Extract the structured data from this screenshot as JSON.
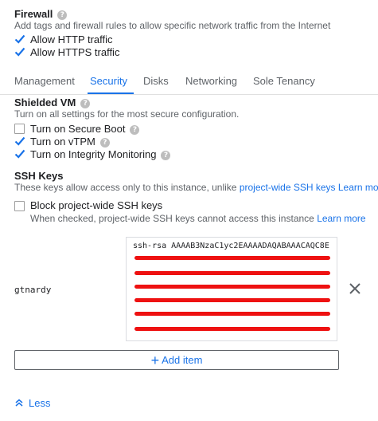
{
  "firewall": {
    "title": "Firewall",
    "description": "Add tags and firewall rules to allow specific network traffic from the Internet",
    "http_label": "Allow HTTP traffic",
    "http_checked": true,
    "https_label": "Allow HTTPS traffic",
    "https_checked": true
  },
  "tabs": [
    {
      "label": "Management",
      "active": false
    },
    {
      "label": "Security",
      "active": true
    },
    {
      "label": "Disks",
      "active": false
    },
    {
      "label": "Networking",
      "active": false
    },
    {
      "label": "Sole Tenancy",
      "active": false
    }
  ],
  "shielded_vm": {
    "title": "Shielded VM",
    "description": "Turn on all settings for the most secure configuration.",
    "options": [
      {
        "label": "Turn on Secure Boot",
        "checked": false
      },
      {
        "label": "Turn on vTPM",
        "checked": true
      },
      {
        "label": "Turn on Integrity Monitoring",
        "checked": true
      }
    ]
  },
  "ssh_keys": {
    "title": "SSH Keys",
    "description_prefix": "These keys allow access only to this instance, unlike ",
    "project_wide_link": "project-wide SSH keys",
    "learn_more": "Learn more",
    "block_label": "Block project-wide SSH keys",
    "block_checked": false,
    "block_hint": "When checked, project-wide SSH keys cannot access this instance",
    "entries": [
      {
        "username": "gtnardy",
        "key_first_line": "ssh-rsa AAAAB3NzaC1yc2EAAAADAQABAAACAQC8E"
      }
    ],
    "add_item_label": "Add item"
  },
  "footer": {
    "less_label": "Less"
  },
  "colors": {
    "accent": "#1a73e8",
    "redaction": "#ee1111"
  }
}
